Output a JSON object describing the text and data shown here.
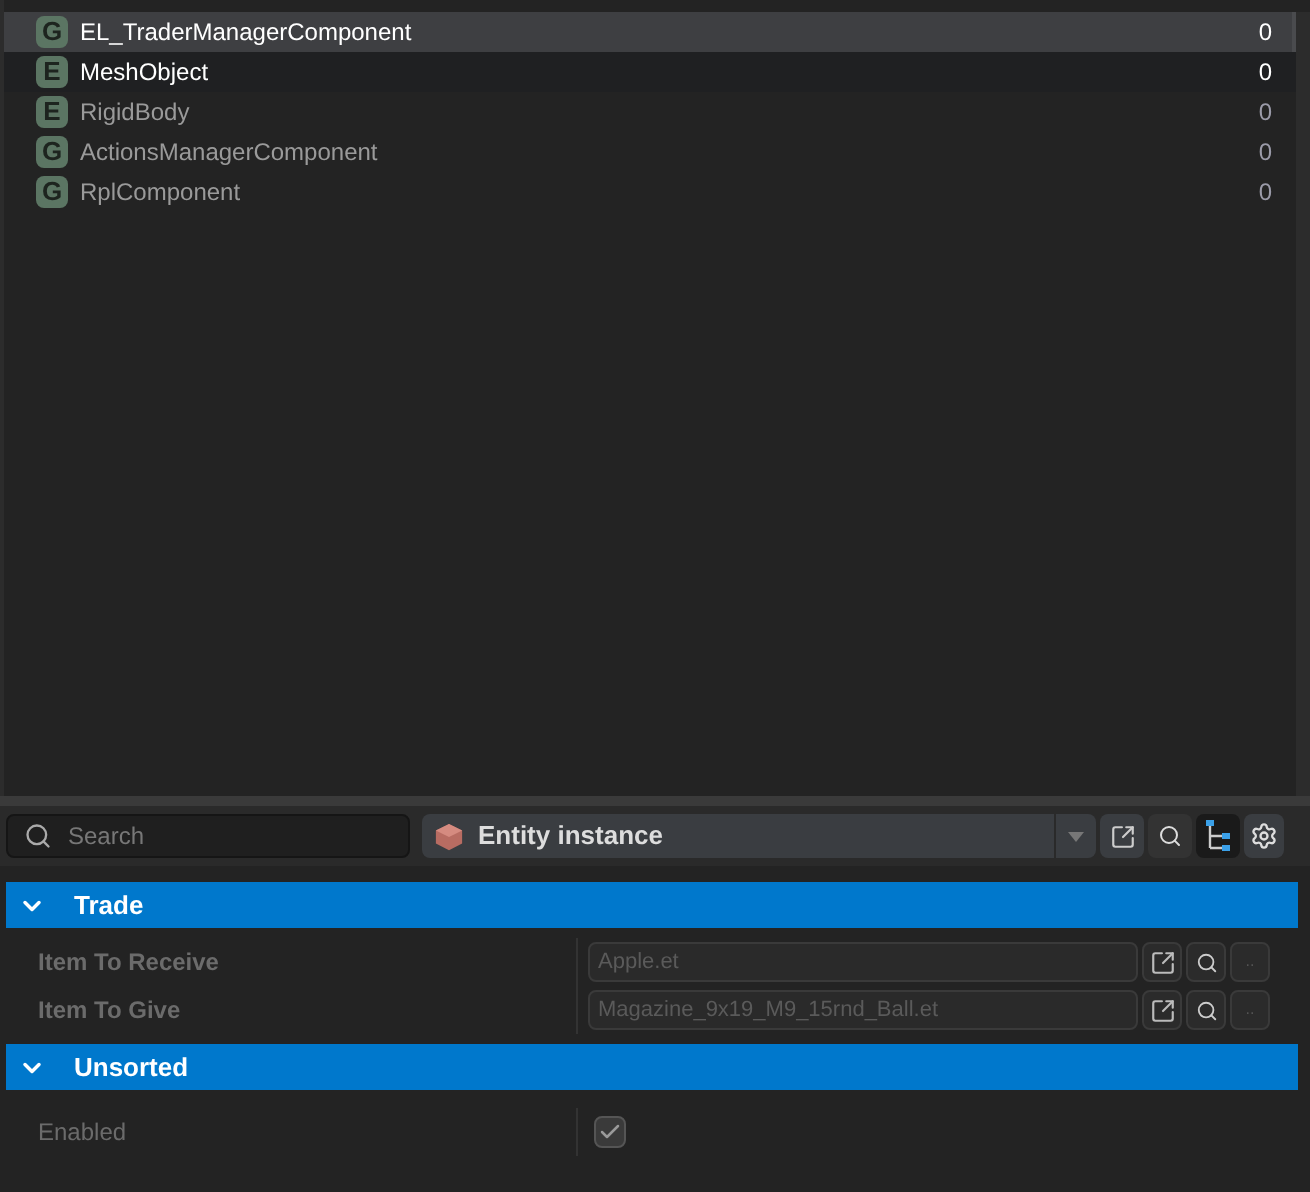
{
  "components": [
    {
      "badge": "G",
      "name": "EL_TraderManagerComponent",
      "count": "0",
      "selected": true,
      "highlighted": false
    },
    {
      "badge": "E",
      "name": "MeshObject",
      "count": "0",
      "selected": false,
      "highlighted": true
    },
    {
      "badge": "E",
      "name": "RigidBody",
      "count": "0",
      "selected": false,
      "highlighted": false
    },
    {
      "badge": "G",
      "name": "ActionsManagerComponent",
      "count": "0",
      "selected": false,
      "highlighted": false
    },
    {
      "badge": "G",
      "name": "RplComponent",
      "count": "0",
      "selected": false,
      "highlighted": false
    }
  ],
  "toolbar": {
    "search": {
      "placeholder": "Search"
    },
    "class_select": {
      "value": "Entity instance"
    },
    "hierarchy_toggle": {
      "on": true
    }
  },
  "sections": [
    {
      "title": "Trade",
      "expanded": true,
      "properties": [
        {
          "kind": "resource",
          "label": "Item To Receive",
          "value": "Apple.et",
          "more": ".."
        },
        {
          "kind": "resource",
          "label": "Item To Give",
          "value": "Magazine_9x19_M9_15rnd_Ball.et",
          "more": ".."
        }
      ]
    },
    {
      "title": "Unsorted",
      "expanded": true,
      "properties": [
        {
          "kind": "checkbox",
          "label": "Enabled",
          "checked": true
        }
      ]
    }
  ]
}
